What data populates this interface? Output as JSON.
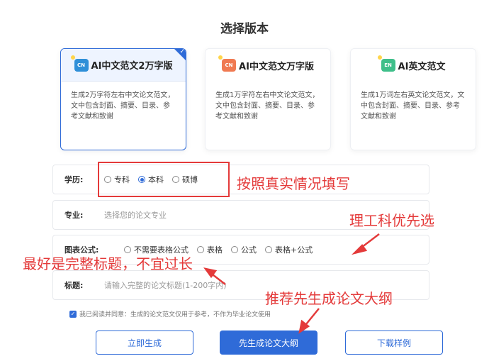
{
  "page_title": "选择版本",
  "cards": [
    {
      "icon": "cn-doc-icon",
      "badge": "CN",
      "color": "#2f8fd8",
      "title": "AI中文范文2万字版",
      "desc": "生成2万字符左右中文论文范文，文中包含封面、摘要、目录、参考文献和致谢",
      "selected": true
    },
    {
      "icon": "cn-doc-icon",
      "badge": "CN",
      "color": "#f07a52",
      "title": "AI中文范文万字版",
      "desc": "生成1万字符左右中文论文范文，文中包含封面、摘要、目录、参考文献和致谢",
      "selected": false
    },
    {
      "icon": "en-doc-icon",
      "badge": "EN",
      "color": "#3fbf8a",
      "title": "AI英文范文",
      "desc": "生成1万词左右英文论文范文，文中包含封面、摘要、目录、参考文献和致谢",
      "selected": false
    }
  ],
  "education": {
    "label": "学历:",
    "options": [
      "专科",
      "本科",
      "硕博"
    ],
    "selected": "本科"
  },
  "major": {
    "label": "专业:",
    "placeholder": "选择您的论文专业"
  },
  "formula": {
    "label": "图表公式:",
    "options": [
      "不需要表格公式",
      "表格",
      "公式",
      "表格+公式"
    ]
  },
  "topic": {
    "label": "标题:",
    "placeholder": "请输入完整的论文标题(1-200字内)"
  },
  "agreement": "我已阅读并同意：生成的论文范文仅用于参考，不作为毕业论文使用",
  "buttons": {
    "generate": "立即生成",
    "outline": "先生成论文大纲",
    "download": "下载样例"
  },
  "annotations": {
    "fill_truth": "按照真实情况填写",
    "science_first": "理工科优先选",
    "full_title": "最好是完整标题，不宜过长",
    "outline_first": "推荐先生成论文大纲"
  },
  "colors": {
    "accent": "#2f6bd8",
    "annotation_red": "#e43a3a"
  }
}
